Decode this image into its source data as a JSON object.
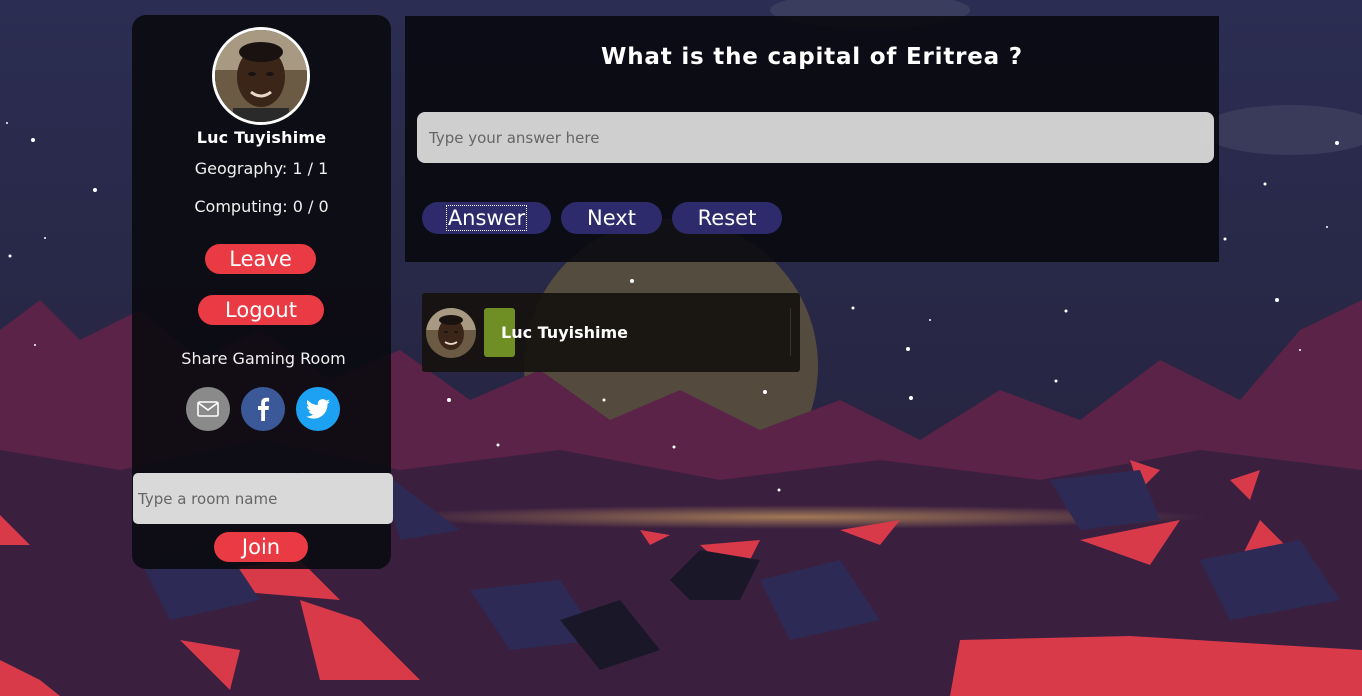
{
  "profile": {
    "name": "Luc Tuyishime",
    "stats": {
      "geography": "Geography: 1 / 1",
      "computing": "Computing: 0 / 0"
    }
  },
  "buttons": {
    "leave": "Leave",
    "logout": "Logout",
    "join": "Join",
    "answer": "Answer",
    "next": "Next",
    "reset": "Reset"
  },
  "share": {
    "label": "Share Gaming Room",
    "icons": [
      "email-icon",
      "facebook-icon",
      "twitter-icon"
    ]
  },
  "room": {
    "placeholder": "Type a room name",
    "value": ""
  },
  "quiz": {
    "question": "What is the capital of Eritrea ?",
    "answer_placeholder": "Type your answer here",
    "answer_value": ""
  },
  "players": [
    {
      "name": "Luc Tuyishime",
      "badge_color": "#6f8e23"
    }
  ],
  "colors": {
    "red_button": "#ea3a43",
    "blue_button": "#2d2b6b",
    "email": "#8a8a8a",
    "facebook": "#3b5998",
    "twitter": "#1da1f2"
  }
}
